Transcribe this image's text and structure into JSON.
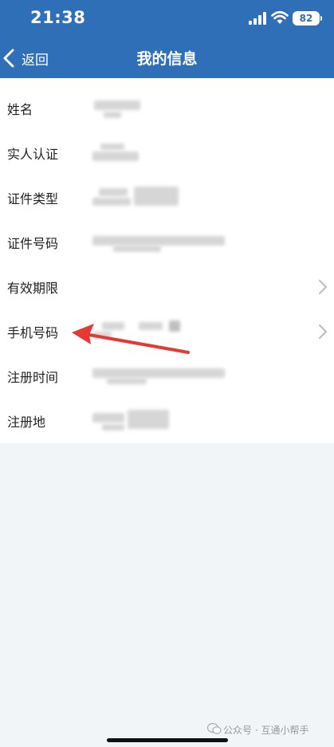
{
  "status_bar": {
    "time": "21:38",
    "battery": "82"
  },
  "header": {
    "back_label": "返回",
    "title": "我的信息"
  },
  "fields": [
    {
      "label": "姓名",
      "has_chevron": false
    },
    {
      "label": "实人认证",
      "has_chevron": false
    },
    {
      "label": "证件类型",
      "has_chevron": false
    },
    {
      "label": "证件号码",
      "has_chevron": false
    },
    {
      "label": "有效期限",
      "has_chevron": true
    },
    {
      "label": "手机号码",
      "has_chevron": true
    },
    {
      "label": "注册时间",
      "has_chevron": false
    },
    {
      "label": "注册地",
      "has_chevron": false
    }
  ],
  "watermark": "公众号 · 互通小帮手",
  "colors": {
    "header_bg": "#2f6fb8",
    "page_bg": "#f1f5f8",
    "annotation_arrow": "#e53935"
  }
}
